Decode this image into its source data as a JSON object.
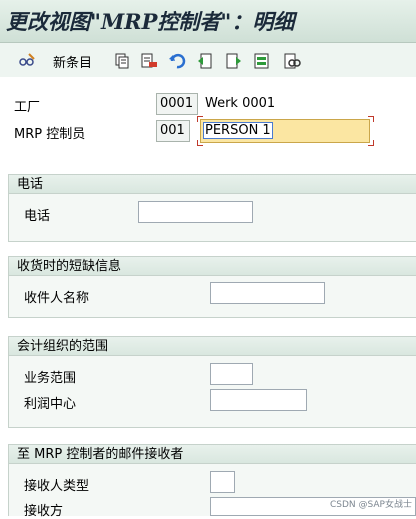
{
  "window": {
    "title": "更改视图\"MRP控制者\"：明细"
  },
  "toolbar": {
    "new_entries_label": "新条目",
    "icons": [
      "glasses-edit-icon",
      "copy-icon",
      "delete-icon",
      "undo-icon",
      "prev-entry-icon",
      "next-entry-icon",
      "select-all-icon",
      "where-used-icon"
    ]
  },
  "header": {
    "plant_label": "工厂",
    "plant_value": "0001",
    "plant_name": "Werk 0001",
    "mrp_controller_label": "MRP 控制员",
    "mrp_controller_value": "001",
    "mrp_controller_name": "PERSON 1"
  },
  "groups": {
    "phone": {
      "title": "电话",
      "phone_label": "电话",
      "phone_value": ""
    },
    "shortage": {
      "title": "收货时的短缺信息",
      "recipient_name_label": "收件人名称",
      "recipient_name_value": ""
    },
    "org": {
      "title": "会计组织的范围",
      "business_area_label": "业务范围",
      "business_area_value": "",
      "profit_center_label": "利润中心",
      "profit_center_value": ""
    },
    "mail": {
      "title": "至 MRP 控制者的邮件接收者",
      "recipient_type_label": "接收人类型",
      "recipient_type_value": "",
      "recipient_label": "接收方",
      "recipient_value": ""
    }
  },
  "watermark": "CSDN @SAP女战士"
}
